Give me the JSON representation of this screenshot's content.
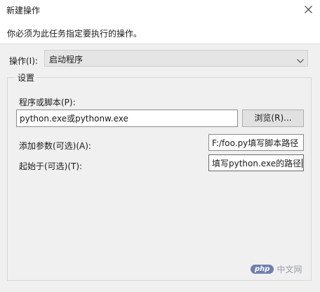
{
  "window": {
    "title": "新建操作",
    "close_icon": "close-icon"
  },
  "header": {
    "instruction": "你必须为此任务指定要执行的操作。"
  },
  "action": {
    "label": "操作(I):",
    "selected": "启动程序",
    "icon": "chevron-down-icon"
  },
  "settings": {
    "legend": "设置",
    "program_label": "程序或脚本(P):",
    "program_value": "python.exe或pythonw.exe",
    "browse_label": "浏览(R)...",
    "args_label": "添加参数(可选)(A):",
    "args_value": "F:/foo.py填写脚本路径",
    "startin_label": "起始于(可选)(T):",
    "startin_value": "填写python.exe的路径"
  },
  "watermark": {
    "logo_text": "php",
    "text": "中文网"
  }
}
